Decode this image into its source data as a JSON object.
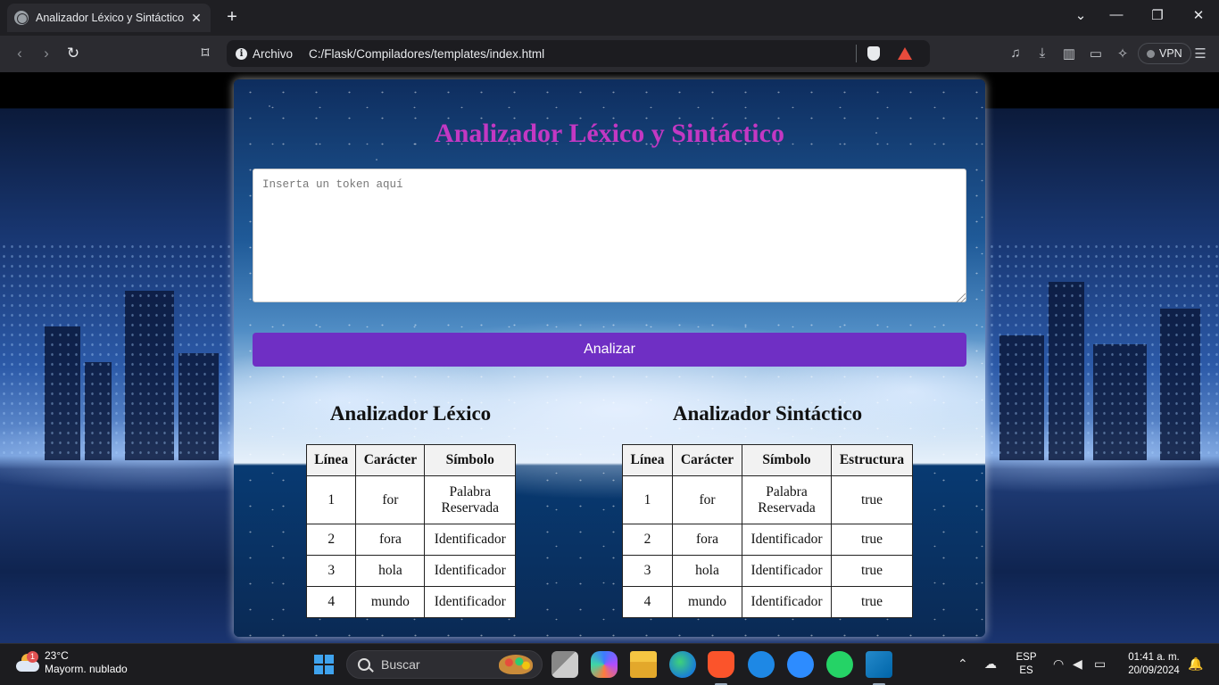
{
  "browser": {
    "tab_title": "Analizador Léxico y Sintáctico",
    "scheme_label": "Archivo",
    "url": "C:/Flask/Compiladores/templates/index.html",
    "vpn_label": "VPN"
  },
  "page": {
    "title": "Analizador Léxico y Sintáctico",
    "input_placeholder": "Inserta un token aquí",
    "analyze_button": "Analizar",
    "lexico": {
      "title": "Analizador Léxico",
      "headers": [
        "Línea",
        "Carácter",
        "Símbolo"
      ],
      "rows": [
        [
          "1",
          "for",
          "Palabra Reservada"
        ],
        [
          "2",
          "fora",
          "Identificador"
        ],
        [
          "3",
          "hola",
          "Identificador"
        ],
        [
          "4",
          "mundo",
          "Identificador"
        ]
      ]
    },
    "sintactico": {
      "title": "Analizador Sintáctico",
      "headers": [
        "Línea",
        "Carácter",
        "Símbolo",
        "Estructura"
      ],
      "rows": [
        [
          "1",
          "for",
          "Palabra Reservada",
          "true"
        ],
        [
          "2",
          "fora",
          "Identificador",
          "true"
        ],
        [
          "3",
          "hola",
          "Identificador",
          "true"
        ],
        [
          "4",
          "mundo",
          "Identificador",
          "true"
        ]
      ]
    }
  },
  "taskbar": {
    "weather_temp": "23°C",
    "weather_desc": "Mayorm. nublado",
    "weather_badge": "1",
    "search_placeholder": "Buscar",
    "lang_top": "ESP",
    "lang_bottom": "ES",
    "time": "01:41 a. m.",
    "date": "20/09/2024"
  },
  "colors": {
    "title": "#c338c3",
    "button": "#6f2fc4"
  }
}
